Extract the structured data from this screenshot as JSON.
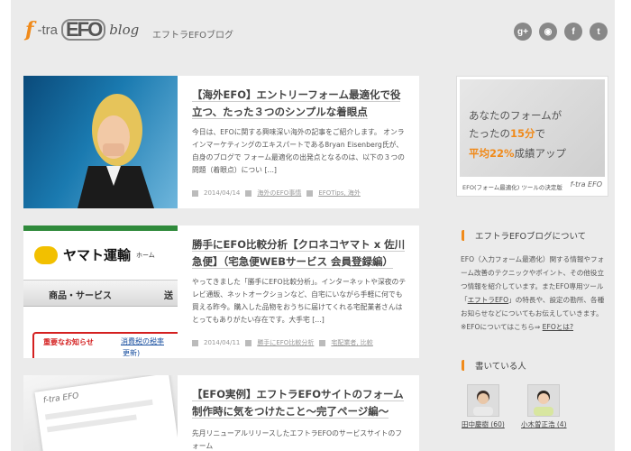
{
  "header": {
    "logo": {
      "f": "f",
      "tra": "-tra",
      "efo": "EFO",
      "blog": "blog"
    },
    "site_title": "エフトラEFOブログ",
    "social": [
      {
        "icon": "google-plus-icon",
        "glyph": "g+"
      },
      {
        "icon": "rss-icon",
        "glyph": "◉"
      },
      {
        "icon": "facebook-icon",
        "glyph": "f"
      },
      {
        "icon": "twitter-icon",
        "glyph": "t"
      }
    ]
  },
  "articles": [
    {
      "title": "【海外EFO】エントリーフォーム最適化で役立つ、たった３つのシンプルな着眼点",
      "excerpt": "今日は、EFOに関する興味深い海外の記事をご紹介します。 オンラインマーケティングのエキスパートである8ryan Eisenberg氏が、自身のブログで フォーム最適化の出発点となるのは、以下の３つの問題（着眼点）につい [...]",
      "date": "2014/04/14",
      "category": "海外のEFO事情",
      "tags": "EFOTips, 海外"
    },
    {
      "title": "勝手にEFO比較分析【クロネコヤマト x 佐川急便】（宅急便WEBサービス 会員登録編）",
      "excerpt": "やってきました「勝手にEFO比較分析」。インターネットや深夜のテレビ通販、ネットオークションなど、自宅にいながら手軽に何でも買える昨今。購入した品物をおうちに届けてくれる宅配業者さんはとってもありがたい存在です。大手宅 [...]",
      "date": "2014/04/11",
      "category": "勝手にEFO比較分析",
      "tags": "宅配業者, 比較",
      "thumb_logo": "ヤマト運輸",
      "thumb_home": "ホーム",
      "thumb_nav": "商品・サービス",
      "thumb_nav2": "送",
      "thumb_notice": "重要なお知らせ",
      "thumb_notice_text": "消費税の税率",
      "thumb_notice_text2": "更新)"
    },
    {
      "title": "【EFO実例】エフトラEFOサイトのフォーム制作時に気をつけたこと〜完了ページ編〜",
      "excerpt": "先月リニューアルリリースしたエフトラEFOのサービスサイトのフォーム",
      "thumb_logo": "f-tra EFO"
    }
  ],
  "sidebar": {
    "banner": {
      "line1": "あなたのフォームが",
      "line2_pre": "たったの",
      "line2_hl": "15分",
      "line2_post": "で",
      "line3_pre": "平均",
      "line3_hl": "22%",
      "line3_post": "成績アップ",
      "caption": "EFO(フォーム最適化) ツールの決定版",
      "logo": "f-tra EFO"
    },
    "about": {
      "heading": "エフトラEFOブログについて",
      "text1": "EFO（入力フォーム最適化）関する情報やフォーム改善のテクニックやポイント、その他役立つ情報を紹介しています。またEFO専用ツール「",
      "link1": "エフトラEFO",
      "text2": "」の特長や、設定の勘所、各種お知らせなどについてもお伝えしていきます。",
      "text3": "※EFOについてはこちら⇒ ",
      "link2": "EFOとは?"
    },
    "authors": {
      "heading": "書いている人",
      "list": [
        {
          "name": "田中慶樹 (60)"
        },
        {
          "name": "小木曽正浩 (4)"
        }
      ]
    }
  }
}
